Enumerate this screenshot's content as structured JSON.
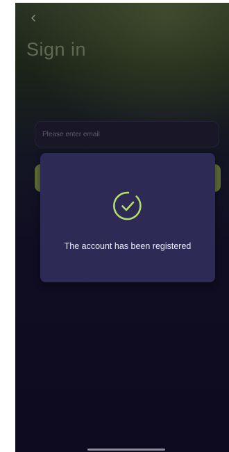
{
  "header": {
    "title": "Sign in"
  },
  "form": {
    "email_placeholder": "Please enter email",
    "email_value": ""
  },
  "dialog": {
    "message": "The account has been registered",
    "icon": "check-circle-icon"
  },
  "colors": {
    "accent": "#b8dd6a",
    "dialog_bg": "#2d2b55",
    "button_bg": "#5d6a36"
  }
}
